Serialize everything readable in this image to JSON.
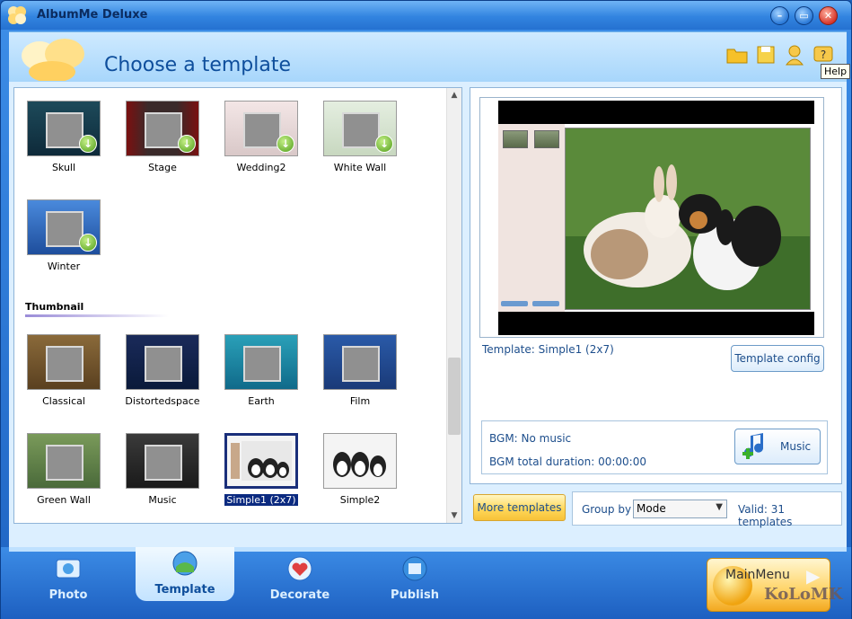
{
  "window": {
    "title": "AlbumMe Deluxe"
  },
  "header": {
    "page_title": "Choose a template",
    "tooltip": "Help",
    "icons": [
      "folder-icon",
      "save-icon",
      "user-icon",
      "help-icon"
    ]
  },
  "templates_top": [
    {
      "label": "Skull"
    },
    {
      "label": "Stage"
    },
    {
      "label": "Wedding2"
    },
    {
      "label": "White Wall"
    },
    {
      "label": "Winter"
    }
  ],
  "section": {
    "title": "Thumbnail"
  },
  "templates_thumb": [
    {
      "label": "Classical"
    },
    {
      "label": "Distortedspace"
    },
    {
      "label": "Earth"
    },
    {
      "label": "Film"
    },
    {
      "label": "Green Wall"
    },
    {
      "label": "Music"
    },
    {
      "label": "Simple1 (2x7)"
    },
    {
      "label": "Simple2"
    }
  ],
  "preview": {
    "caption": "Template:  Simple1 (2x7)",
    "config_button": "Template config",
    "bgm": "BGM: No music",
    "bgm_duration": "BGM total duration: 00:00:00",
    "music_button": "Music"
  },
  "footer": {
    "more_templates": "More templates",
    "group_by_label": "Group by",
    "group_by_value": "Mode",
    "valid": "Valid: 31 templates"
  },
  "tabs": [
    {
      "label": "Photo"
    },
    {
      "label": "Template"
    },
    {
      "label": "Decorate"
    },
    {
      "label": "Publish"
    }
  ],
  "main_menu": "MainMenu",
  "watermark": "KoLoMK",
  "colors": {
    "accent": "#1e63c2",
    "panel": "#dcefff",
    "selected": "#0b2a80"
  }
}
